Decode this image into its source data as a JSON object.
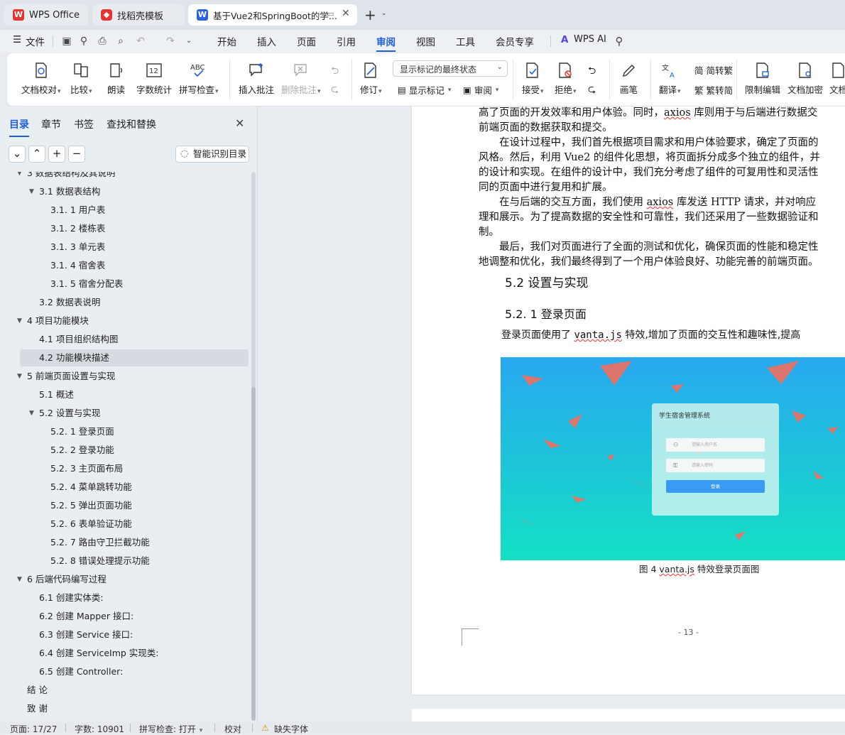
{
  "tabs": [
    {
      "label": "WPS Office"
    },
    {
      "label": "找稻壳模板"
    },
    {
      "label": "基于Vue2和SpringBoot的学..."
    }
  ],
  "menu": {
    "file": "文件",
    "items": [
      "开始",
      "插入",
      "页面",
      "引用",
      "审阅",
      "视图",
      "工具",
      "会员专享"
    ],
    "selected": "审阅",
    "ai": "WPS AI"
  },
  "ribbon": {
    "doc_check": "文档校对",
    "compare": "比较",
    "read_aloud": "朗读",
    "word_count": "字数统计",
    "spell_check": "拼写检查",
    "insert_comment": "插入批注",
    "delete_comment": "删除批注",
    "revise": "修订",
    "track_state": "显示标记的最终状态",
    "show_marks": "显示标记",
    "review": "审阅",
    "accept": "接受",
    "reject": "拒绝",
    "pen": "画笔",
    "translate": "翻译",
    "to_traditional": "简转繁",
    "to_simplified": "繁转简",
    "restrict_edit": "限制编辑",
    "encrypt": "文档加密",
    "more": "文档"
  },
  "panel": {
    "tabs": [
      "目录",
      "章节",
      "书签",
      "查找和替换"
    ],
    "selected": "目录",
    "ai_toc": "智能识别目录",
    "toc": [
      {
        "label": "3   数据表结构及其说明",
        "level": 0,
        "arrow": "expanded"
      },
      {
        "label": "3.1   数据表结构",
        "level": 1,
        "arrow": "expanded"
      },
      {
        "label": "3.1. 1   用户表",
        "level": 2
      },
      {
        "label": "3.1. 2   楼栋表",
        "level": 2
      },
      {
        "label": "3.1. 3   单元表",
        "level": 2
      },
      {
        "label": "3.1. 4   宿舍表",
        "level": 2
      },
      {
        "label": "3.1. 5   宿舍分配表",
        "level": 2
      },
      {
        "label": "3.2   数据表说明",
        "level": 1
      },
      {
        "label": "4   项目功能模块",
        "level": 0,
        "arrow": "expanded"
      },
      {
        "label": "4.1   项目组织结构图",
        "level": 1
      },
      {
        "label": "4.2   功能模块描述",
        "level": 1,
        "highlight": true
      },
      {
        "label": "5   前端页面设置与实现",
        "level": 0,
        "arrow": "expanded"
      },
      {
        "label": "5.1   概述",
        "level": 1
      },
      {
        "label": "5.2   设置与实现",
        "level": 1,
        "arrow": "expanded"
      },
      {
        "label": "5.2. 1   登录页面",
        "level": 2
      },
      {
        "label": "5.2. 2   登录功能",
        "level": 2
      },
      {
        "label": "5.2. 3   主页面布局",
        "level": 2
      },
      {
        "label": "5.2. 4   菜单跳转功能",
        "level": 2
      },
      {
        "label": "5.2. 5   弹出页面功能",
        "level": 2
      },
      {
        "label": "5.2. 6   表单验证功能",
        "level": 2
      },
      {
        "label": "5.2. 7   路由守卫拦截功能",
        "level": 2
      },
      {
        "label": "5.2. 8   错误处理提示功能",
        "level": 2
      },
      {
        "label": "6   后端代码编写过程",
        "level": 0,
        "arrow": "expanded"
      },
      {
        "label": "6.1   创建实体类:",
        "level": 1
      },
      {
        "label": "6.2   创建 Mapper 接口:",
        "level": 1
      },
      {
        "label": "6.3   创建 Service 接口:",
        "level": 1
      },
      {
        "label": "6.4   创建 ServiceImp 实现类:",
        "level": 1
      },
      {
        "label": "6.5   创建 Controller:",
        "level": 1
      },
      {
        "label": "结    论",
        "level": 0
      },
      {
        "label": "致    谢",
        "level": 0
      }
    ]
  },
  "doc": {
    "lines": [
      "高了页面的开发效率和用户体验。同时，axios 库则用于与后端进行数据交",
      "前端页面的数据获取和提交。",
      "　　在设计过程中，我们首先根据项目需求和用户体验要求，确定了页面的",
      "风格。然后，利用 Vue2 的组件化思想，将页面拆分成多个独立的组件，并",
      "的设计和实现。在组件的设计中，我们充分考虑了组件的可复用性和灵活性",
      "同的页面中进行复用和扩展。",
      "　　在与后端的交互方面，我们使用 axios 库发送 HTTP 请求，并对响应",
      "理和展示。为了提高数据的安全性和可靠性，我们还采用了一些数据验证和",
      "制。",
      "　　最后，我们对页面进行了全面的测试和优化，确保页面的性能和稳定性",
      "地调整和优化，我们最终得到了一个用户体验良好、功能完善的前端页面。"
    ],
    "h2": "5.2   设置与实现",
    "h3": "5.2. 1   登录页面",
    "body_prefix": "登录页面使用了 ",
    "body_code": "vanta.js",
    "body_suffix": " 特效,增加了页面的交互性和趣味性,提高",
    "figure": {
      "title": "学生宿舍管理系统",
      "username_ph": "请输入用户名",
      "password_ph": "请输入密码",
      "login": "登录"
    },
    "caption_prefix": "图 4 ",
    "caption_code": "vanta.js",
    "caption_suffix": " 特效登录页面图",
    "page_num": "- 13 -"
  },
  "status": {
    "page": "页面: 17/27",
    "words": "字数: 10901",
    "spell": "拼写检查: 打开",
    "proof": "校对",
    "missing_font": "缺失字体"
  },
  "colors": {
    "accent": "#1e5fdb",
    "wps_red": "#e5352f",
    "figure_top": "#28a8f0",
    "figure_bottom": "#13e0c4"
  }
}
